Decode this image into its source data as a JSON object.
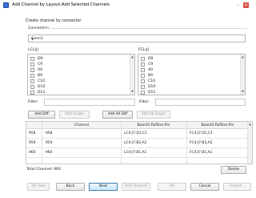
{
  "window": {
    "title": "Add Channel by Layout:Add Selected Channels"
  },
  "subtitle": "Create channel by connector",
  "connection": {
    "group_label": "Connection",
    "selected": "Conn1"
  },
  "left_list": {
    "label": "LCL(J)",
    "items": [
      "D9",
      "C9",
      "A0",
      "B9",
      "C10",
      "D10",
      "D11"
    ]
  },
  "right_list": {
    "label": "FCL(J)",
    "items": [
      "D9",
      "C9",
      "A0",
      "B9",
      "C10",
      "D10",
      "D11"
    ]
  },
  "filters": {
    "left_label": "Filter:",
    "right_label": "Filter:"
  },
  "actions": {
    "add_diff": "Add Diff",
    "add_single": "Add Single",
    "add_all_diff": "Add All Diff",
    "add_all_single": "Add All Single"
  },
  "table": {
    "columns": [
      "Channel",
      "Board1:RefDes:Pin",
      "Board2:RefDes:Pin"
    ],
    "rows": [
      {
        "num": "958",
        "channel": "958",
        "b1": "LC4:J7:D1,C1",
        "b2": "FC4:J7:D1,C1"
      },
      {
        "num": "959",
        "channel": "959",
        "b1": "LC4:J7:B2,A2",
        "b2": "FC4:J7:B2,A2"
      },
      {
        "num": "960",
        "channel": "960",
        "b1": "LC4:J7:B1,A1",
        "b2": "FC4:J7:B1,A1"
      }
    ]
  },
  "total": "Total Channel: 960",
  "footer": {
    "delete": "Delete",
    "view_3d": "3D View",
    "back": "Back",
    "next": "Next",
    "add_channel": "Add Channel",
    "ok": "Ok",
    "cancel": "Cancel",
    "export": "Export..."
  },
  "icons": {
    "window": "app-window-icon",
    "minimize": "minimize-icon",
    "close": "close-icon"
  },
  "colors": {
    "close_button": "#d94c3d",
    "app_icon": "#3b6fd6",
    "primary_button": "#cfe7f8"
  }
}
